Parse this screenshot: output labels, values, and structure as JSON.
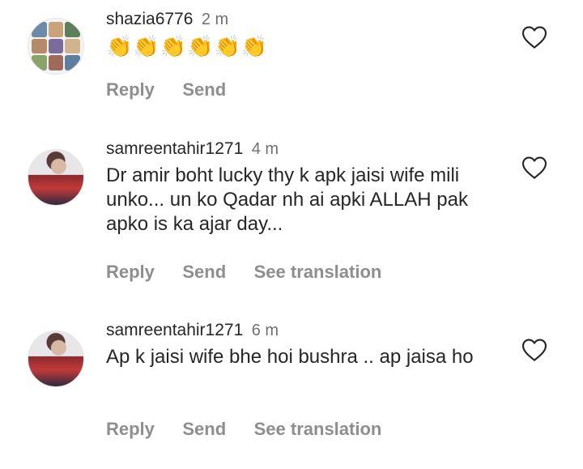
{
  "comments": [
    {
      "username": "shazia6776",
      "time": "2 m",
      "text": "👏👏👏👏👏👏",
      "actions": [
        "Reply",
        "Send"
      ]
    },
    {
      "username": "samreentahir1271",
      "time": "4 m",
      "text": "Dr amir boht lucky thy k apk jaisi wife mili unko... un ko Qadar nh ai apki ALLAH pak apko is ka ajar day...",
      "actions": [
        "Reply",
        "Send",
        "See translation"
      ]
    },
    {
      "username": "samreentahir1271",
      "time": "6 m",
      "text": "Ap k jaisi wife bhe hoi bushra .. ap jaisa ho",
      "actions": [
        "Reply",
        "Send",
        "See translation"
      ]
    }
  ],
  "icons": {
    "like": "heart-outline-icon",
    "avatar_collage": "photo-collage-avatar",
    "avatar_photo": "profile-photo-avatar"
  },
  "colors": {
    "text": "#262626",
    "muted": "#8e8e8e",
    "heart_stroke": "#262626"
  }
}
